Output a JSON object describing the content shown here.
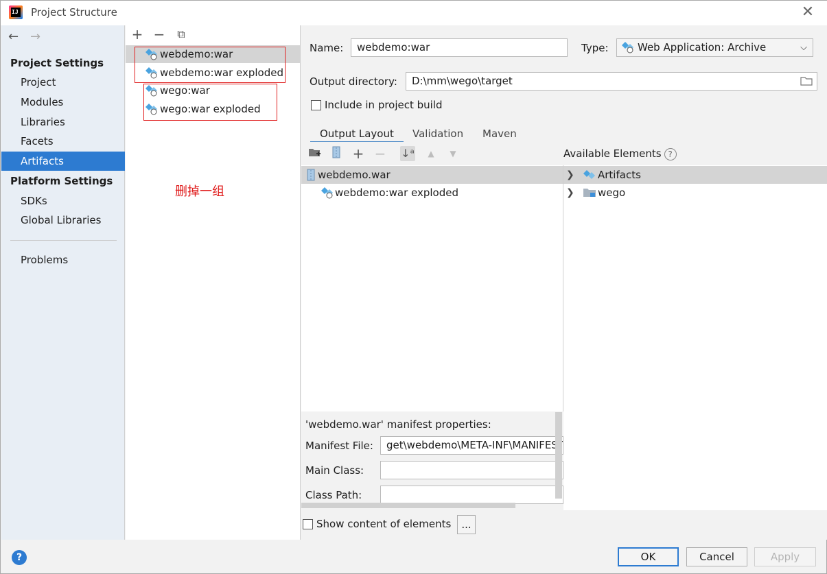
{
  "window": {
    "title": "Project Structure",
    "logo_text": "IJ",
    "close_glyph": "✕"
  },
  "sidebar": {
    "back_glyph": "←",
    "forward_glyph": "→",
    "project_settings_header": "Project Settings",
    "project_items": [
      {
        "label": "Project"
      },
      {
        "label": "Modules"
      },
      {
        "label": "Libraries"
      },
      {
        "label": "Facets"
      },
      {
        "label": "Artifacts"
      }
    ],
    "platform_settings_header": "Platform Settings",
    "platform_items": [
      {
        "label": "SDKs"
      },
      {
        "label": "Global Libraries"
      }
    ],
    "problems_label": "Problems",
    "selected_item": "Artifacts"
  },
  "artifact_list": {
    "toolbar": {
      "add": "+",
      "remove": "−",
      "copy": "⧉"
    },
    "items": [
      {
        "label": "webdemo:war"
      },
      {
        "label": "webdemo:war exploded"
      },
      {
        "label": "wego:war"
      },
      {
        "label": "wego:war exploded"
      }
    ],
    "annotation": "删掉一组"
  },
  "detail": {
    "name_label": "Name:",
    "name_value": "webdemo:war",
    "type_label": "Type:",
    "type_value": "Web Application: Archive",
    "output_dir_label": "Output directory:",
    "output_dir_value": "D:\\mm\\wego\\target",
    "include_build_label": "Include in project build",
    "tabs": [
      {
        "label": "Output Layout"
      },
      {
        "label": "Validation"
      },
      {
        "label": "Maven"
      }
    ],
    "layout_tree": [
      {
        "label": "webdemo.war"
      },
      {
        "label": "webdemo:war exploded"
      }
    ],
    "available_elements_label": "Available Elements",
    "available_help": "?",
    "available_tree": [
      {
        "label": "Artifacts"
      },
      {
        "label": "wego"
      }
    ],
    "manifest": {
      "header": "'webdemo.war' manifest properties:",
      "file_label": "Manifest File:",
      "file_value": "get\\webdemo\\META-INF\\MANIFEST.MF",
      "main_class_label": "Main Class:",
      "main_class_value": "",
      "class_path_label": "Class Path:",
      "class_path_value": ""
    },
    "show_content_label": "Show content of elements",
    "ellipsis_button": "..."
  },
  "footer": {
    "help": "?",
    "ok": "OK",
    "cancel": "Cancel",
    "apply": "Apply"
  },
  "colors": {
    "selection_blue": "#2d7bd1",
    "annotation_red": "#e02020"
  }
}
